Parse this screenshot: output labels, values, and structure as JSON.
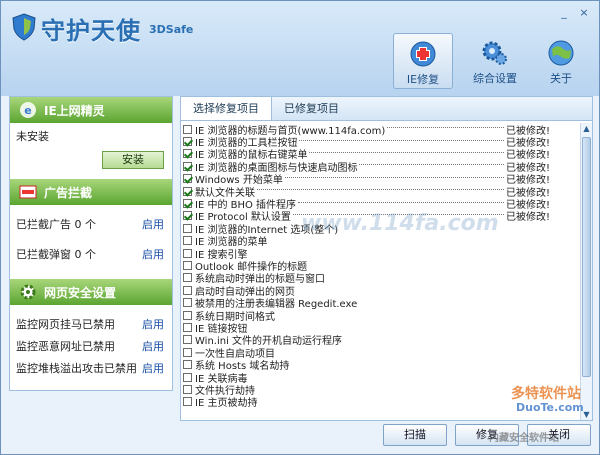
{
  "app": {
    "title": "守护天使",
    "subtitle": "3DSafe"
  },
  "toolbar": [
    {
      "label": "IE修复",
      "icon": "ie-repair-icon"
    },
    {
      "label": "综合设置",
      "icon": "settings-gears-icon"
    },
    {
      "label": "关于",
      "icon": "about-globe-icon"
    }
  ],
  "window_controls": {
    "min": "_",
    "close": "×"
  },
  "left": {
    "sections": [
      {
        "title": "IE上网精灵",
        "icon": "ie-wizard-icon"
      },
      {
        "title": "广告拦截",
        "icon": "ad-block-icon"
      },
      {
        "title": "网页安全设置",
        "icon": "gear-shield-icon"
      }
    ],
    "wizard_status": "未安装",
    "install_label": "安装",
    "ad_rows": [
      {
        "label": "已拦截广告 0 个",
        "action": "启用"
      },
      {
        "label": "已拦截弹窗 0 个",
        "action": "启用"
      }
    ],
    "security_rows": [
      {
        "label": "监控网页挂马已禁用",
        "action": "启用"
      },
      {
        "label": "监控恶意网址已禁用",
        "action": "启用"
      },
      {
        "label": "监控堆栈溢出攻击已禁用",
        "action": "启用"
      }
    ]
  },
  "tabs": [
    "选择修复项目",
    "已修复项目"
  ],
  "items": [
    {
      "label": "IE 浏览器的标题与首页(www.114fa.com)",
      "status": "已被修改!",
      "checked": false
    },
    {
      "label": "IE 浏览器的工具栏按钮",
      "status": "已被修改!",
      "checked": true
    },
    {
      "label": "IE 浏览器的鼠标右键菜单",
      "status": "已被修改!",
      "checked": true
    },
    {
      "label": "IE 浏览器的桌面图标与快速启动图标",
      "status": "已被修改!",
      "checked": true
    },
    {
      "label": "Windows 开始菜单",
      "status": "已被修改!",
      "checked": true
    },
    {
      "label": "默认文件关联",
      "status": "已被修改!",
      "checked": true
    },
    {
      "label": "IE 中的 BHO 插件程序",
      "status": "已被修改!",
      "checked": true
    },
    {
      "label": "IE Protocol 默认设置",
      "status": "已被修改!",
      "checked": true
    },
    {
      "label": "IE 浏览器的Internet 选项(整个)",
      "status": "",
      "checked": false
    },
    {
      "label": "IE 浏览器的菜单",
      "status": "",
      "checked": false
    },
    {
      "label": "IE 搜索引擎",
      "status": "",
      "checked": false
    },
    {
      "label": "Outlook 邮件操作的标题",
      "status": "",
      "checked": false
    },
    {
      "label": "系统启动时弹出的标题与窗口",
      "status": "",
      "checked": false
    },
    {
      "label": "启动时自动弹出的网页",
      "status": "",
      "checked": false
    },
    {
      "label": "被禁用的注册表编辑器 Regedit.exe",
      "status": "",
      "checked": false
    },
    {
      "label": "系统日期时间格式",
      "status": "",
      "checked": false
    },
    {
      "label": "IE 链接按钮",
      "status": "",
      "checked": false
    },
    {
      "label": "Win.ini 文件的开机自动运行程序",
      "status": "",
      "checked": false
    },
    {
      "label": "一次性自启动项目",
      "status": "",
      "checked": false
    },
    {
      "label": "系统 Hosts 域名劫持",
      "status": "",
      "checked": false
    },
    {
      "label": "IE 关联病毒",
      "status": "",
      "checked": false
    },
    {
      "label": "文件执行劫持",
      "status": "",
      "checked": false
    },
    {
      "label": "IE 主页被劫持",
      "status": "",
      "checked": false
    }
  ],
  "buttons": {
    "scan": "扫描",
    "repair": "修复",
    "close": "关闭"
  },
  "watermarks": {
    "site1": "www.114fa.com",
    "site2": "多特软件站",
    "site3": "DuoTe.com",
    "site4": "内藏安全软件站"
  }
}
